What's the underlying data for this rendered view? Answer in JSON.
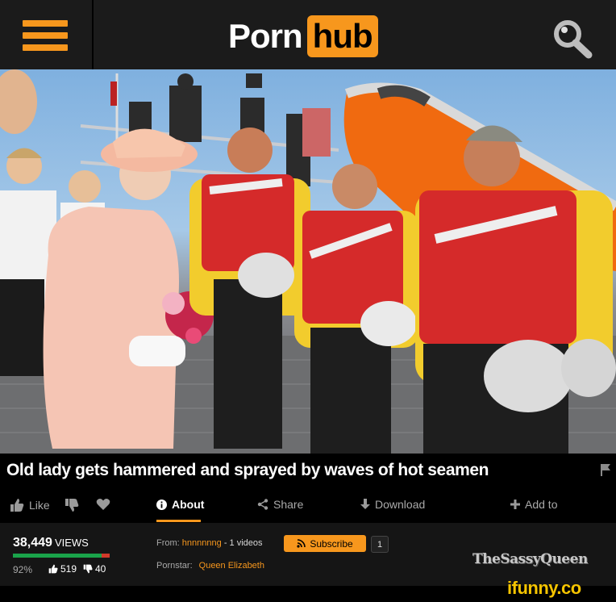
{
  "header": {
    "logo_word": "Porn",
    "logo_badge": "hub"
  },
  "icons": {
    "menu": "hamburger-icon",
    "search": "magnifier-icon",
    "flag": "flag-icon"
  },
  "colors": {
    "accent": "#f7971d",
    "background": "#000000",
    "header_bg": "#1b1b1b",
    "like_green": "#1aa34a",
    "dislike_red": "#d03a2a"
  },
  "video": {
    "title": "Old lady gets hammered and sprayed by waves of hot seamen"
  },
  "actions": {
    "like": "Like",
    "about": "About",
    "share": "Share",
    "download": "Download",
    "add_to": "Add to"
  },
  "stats": {
    "views_count": "38,449",
    "views_label": "VIEWS",
    "rating_percent": "92%",
    "rating_value": 0.92,
    "likes": "519",
    "dislikes": "40"
  },
  "uploader": {
    "from_label": "From:",
    "username": "hnnnnnng",
    "videos": "- 1 videos",
    "subscribe_label": "Subscribe",
    "subscriber_count": "1",
    "pornstar_label": "Pornstar:",
    "pornstar_name": "Queen Elizabeth"
  },
  "watermarks": {
    "sassy": "TheSassyQueen",
    "ifunny": "ifunny.co"
  }
}
